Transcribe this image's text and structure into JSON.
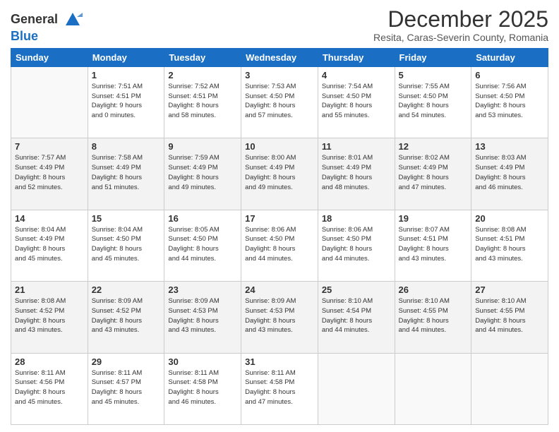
{
  "logo": {
    "line1": "General",
    "line2": "Blue"
  },
  "title": "December 2025",
  "subtitle": "Resita, Caras-Severin County, Romania",
  "days_of_week": [
    "Sunday",
    "Monday",
    "Tuesday",
    "Wednesday",
    "Thursday",
    "Friday",
    "Saturday"
  ],
  "weeks": [
    [
      {
        "day": "",
        "info": ""
      },
      {
        "day": "1",
        "info": "Sunrise: 7:51 AM\nSunset: 4:51 PM\nDaylight: 9 hours\nand 0 minutes."
      },
      {
        "day": "2",
        "info": "Sunrise: 7:52 AM\nSunset: 4:51 PM\nDaylight: 8 hours\nand 58 minutes."
      },
      {
        "day": "3",
        "info": "Sunrise: 7:53 AM\nSunset: 4:50 PM\nDaylight: 8 hours\nand 57 minutes."
      },
      {
        "day": "4",
        "info": "Sunrise: 7:54 AM\nSunset: 4:50 PM\nDaylight: 8 hours\nand 55 minutes."
      },
      {
        "day": "5",
        "info": "Sunrise: 7:55 AM\nSunset: 4:50 PM\nDaylight: 8 hours\nand 54 minutes."
      },
      {
        "day": "6",
        "info": "Sunrise: 7:56 AM\nSunset: 4:50 PM\nDaylight: 8 hours\nand 53 minutes."
      }
    ],
    [
      {
        "day": "7",
        "info": "Sunrise: 7:57 AM\nSunset: 4:49 PM\nDaylight: 8 hours\nand 52 minutes."
      },
      {
        "day": "8",
        "info": "Sunrise: 7:58 AM\nSunset: 4:49 PM\nDaylight: 8 hours\nand 51 minutes."
      },
      {
        "day": "9",
        "info": "Sunrise: 7:59 AM\nSunset: 4:49 PM\nDaylight: 8 hours\nand 49 minutes."
      },
      {
        "day": "10",
        "info": "Sunrise: 8:00 AM\nSunset: 4:49 PM\nDaylight: 8 hours\nand 49 minutes."
      },
      {
        "day": "11",
        "info": "Sunrise: 8:01 AM\nSunset: 4:49 PM\nDaylight: 8 hours\nand 48 minutes."
      },
      {
        "day": "12",
        "info": "Sunrise: 8:02 AM\nSunset: 4:49 PM\nDaylight: 8 hours\nand 47 minutes."
      },
      {
        "day": "13",
        "info": "Sunrise: 8:03 AM\nSunset: 4:49 PM\nDaylight: 8 hours\nand 46 minutes."
      }
    ],
    [
      {
        "day": "14",
        "info": "Sunrise: 8:04 AM\nSunset: 4:49 PM\nDaylight: 8 hours\nand 45 minutes."
      },
      {
        "day": "15",
        "info": "Sunrise: 8:04 AM\nSunset: 4:50 PM\nDaylight: 8 hours\nand 45 minutes."
      },
      {
        "day": "16",
        "info": "Sunrise: 8:05 AM\nSunset: 4:50 PM\nDaylight: 8 hours\nand 44 minutes."
      },
      {
        "day": "17",
        "info": "Sunrise: 8:06 AM\nSunset: 4:50 PM\nDaylight: 8 hours\nand 44 minutes."
      },
      {
        "day": "18",
        "info": "Sunrise: 8:06 AM\nSunset: 4:50 PM\nDaylight: 8 hours\nand 44 minutes."
      },
      {
        "day": "19",
        "info": "Sunrise: 8:07 AM\nSunset: 4:51 PM\nDaylight: 8 hours\nand 43 minutes."
      },
      {
        "day": "20",
        "info": "Sunrise: 8:08 AM\nSunset: 4:51 PM\nDaylight: 8 hours\nand 43 minutes."
      }
    ],
    [
      {
        "day": "21",
        "info": "Sunrise: 8:08 AM\nSunset: 4:52 PM\nDaylight: 8 hours\nand 43 minutes."
      },
      {
        "day": "22",
        "info": "Sunrise: 8:09 AM\nSunset: 4:52 PM\nDaylight: 8 hours\nand 43 minutes."
      },
      {
        "day": "23",
        "info": "Sunrise: 8:09 AM\nSunset: 4:53 PM\nDaylight: 8 hours\nand 43 minutes."
      },
      {
        "day": "24",
        "info": "Sunrise: 8:09 AM\nSunset: 4:53 PM\nDaylight: 8 hours\nand 43 minutes."
      },
      {
        "day": "25",
        "info": "Sunrise: 8:10 AM\nSunset: 4:54 PM\nDaylight: 8 hours\nand 44 minutes."
      },
      {
        "day": "26",
        "info": "Sunrise: 8:10 AM\nSunset: 4:55 PM\nDaylight: 8 hours\nand 44 minutes."
      },
      {
        "day": "27",
        "info": "Sunrise: 8:10 AM\nSunset: 4:55 PM\nDaylight: 8 hours\nand 44 minutes."
      }
    ],
    [
      {
        "day": "28",
        "info": "Sunrise: 8:11 AM\nSunset: 4:56 PM\nDaylight: 8 hours\nand 45 minutes."
      },
      {
        "day": "29",
        "info": "Sunrise: 8:11 AM\nSunset: 4:57 PM\nDaylight: 8 hours\nand 45 minutes."
      },
      {
        "day": "30",
        "info": "Sunrise: 8:11 AM\nSunset: 4:58 PM\nDaylight: 8 hours\nand 46 minutes."
      },
      {
        "day": "31",
        "info": "Sunrise: 8:11 AM\nSunset: 4:58 PM\nDaylight: 8 hours\nand 47 minutes."
      },
      {
        "day": "",
        "info": ""
      },
      {
        "day": "",
        "info": ""
      },
      {
        "day": "",
        "info": ""
      }
    ]
  ]
}
